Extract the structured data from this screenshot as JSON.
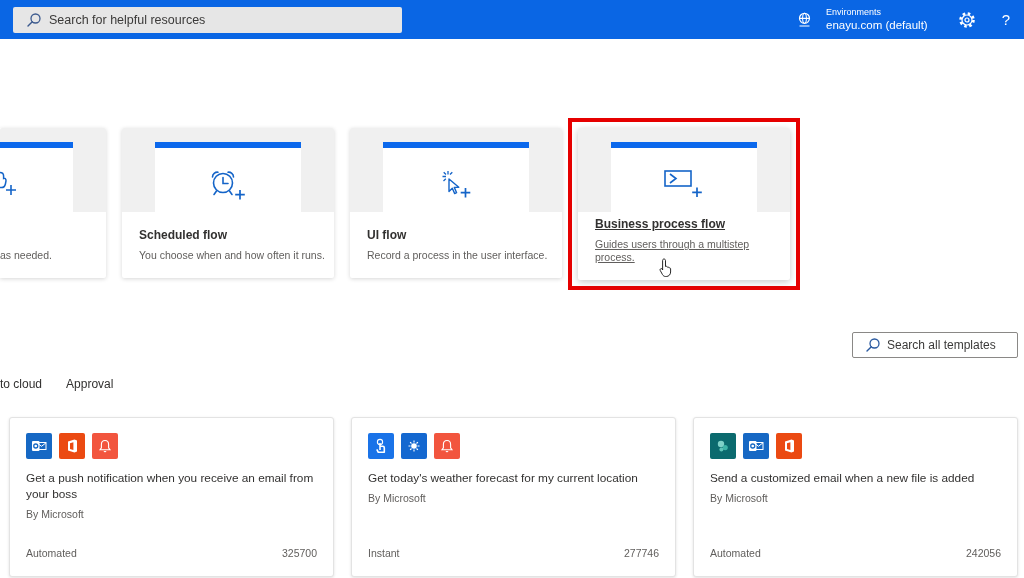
{
  "top_bar": {
    "search": {
      "placeholder": "Search for helpful resources"
    },
    "environment": {
      "label": "Environments",
      "value": "enayu.com (default)"
    },
    "help": "?"
  },
  "flow_cards": [
    {
      "kind": "instant",
      "description": "as needed.",
      "highlighted": false,
      "hovered": false
    },
    {
      "kind": "scheduled",
      "title": "Scheduled flow",
      "description": "You choose when and how often it runs.",
      "highlighted": false,
      "hovered": false
    },
    {
      "kind": "ui",
      "title": "UI flow",
      "description": "Record a process in the user interface.",
      "highlighted": false,
      "hovered": false
    },
    {
      "kind": "process",
      "title": "Business process flow",
      "description": "Guides users through a multistep process.",
      "highlighted": true,
      "hovered": true
    }
  ],
  "template_search": {
    "placeholder": "Search all templates"
  },
  "template_tabs": [
    {
      "label": "to cloud",
      "selected": false
    },
    {
      "label": "Approval",
      "selected": false
    }
  ],
  "templates": [
    {
      "connectors": [
        {
          "kind": "mail",
          "color": "#1668c4"
        },
        {
          "kind": "office",
          "color": "#eb4a12"
        },
        {
          "kind": "bell",
          "color": "#f2553e"
        }
      ],
      "title": "Get a push notification when you receive an email from your boss",
      "author": "By Microsoft",
      "type": "Automated",
      "count": "325700"
    },
    {
      "connectors": [
        {
          "kind": "tap",
          "color": "#1a73e8"
        },
        {
          "kind": "sun",
          "color": "#1468d0"
        },
        {
          "kind": "bell",
          "color": "#f2553e"
        }
      ],
      "title": "Get today's weather forecast for my current location",
      "author": "By Microsoft",
      "type": "Instant",
      "count": "277746"
    },
    {
      "connectors": [
        {
          "kind": "share",
          "color": "#0b6a6e"
        },
        {
          "kind": "mail",
          "color": "#1668c4"
        },
        {
          "kind": "office",
          "color": "#eb4a12"
        }
      ],
      "title": "Send a customized email when a new file is added",
      "author": "By Microsoft",
      "type": "Automated",
      "count": "242056"
    }
  ]
}
